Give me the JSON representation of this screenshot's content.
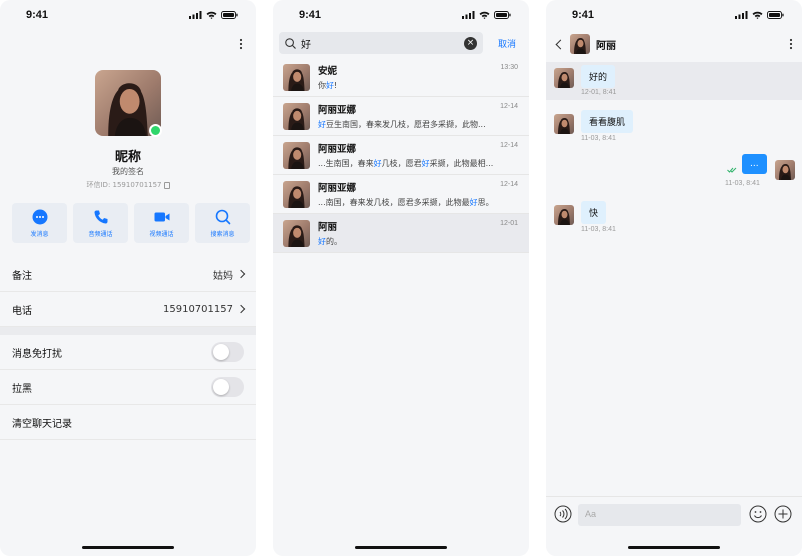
{
  "status": {
    "time": "9:41"
  },
  "profile": {
    "nickname": "昵称",
    "signature": "我的签名",
    "uid": "环信ID: 15910701157",
    "actions": [
      {
        "label": "发消息",
        "icon": "message-icon"
      },
      {
        "label": "音频通话",
        "icon": "phone-icon"
      },
      {
        "label": "视频通话",
        "icon": "video-icon"
      },
      {
        "label": "搜索消息",
        "icon": "search-icon"
      }
    ],
    "remark_label": "备注",
    "remark_value": "姑妈",
    "phone_label": "电话",
    "phone_value": "15910701157",
    "mute_label": "消息免打扰",
    "block_label": "拉黑",
    "clear_label": "清空聊天记录"
  },
  "search": {
    "query": "好",
    "cancel": "取消",
    "results": [
      {
        "name": "安妮",
        "time": "13:30",
        "pre": "你",
        "hit": "好",
        "post": "!"
      },
      {
        "name": "阿丽亚娜",
        "time": "12-14",
        "pre": "",
        "hit": "好",
        "post": "豆生南国，春来发几枝，愿君多采撷，此物..."
      },
      {
        "name": "阿丽亚娜",
        "time": "12-14",
        "pre": "...生南国，春来",
        "hit": "好",
        "post": "几枝，愿君",
        "hit2": "好",
        "post2": "采撷，此物最相..."
      },
      {
        "name": "阿丽亚娜",
        "time": "12-14",
        "pre": "...南国，春来发几枝，愿君多采撷，此物最",
        "hit": "好",
        "post": "思。"
      },
      {
        "name": "阿丽",
        "time": "12-01",
        "pre": "",
        "hit": "好",
        "post": "的。"
      }
    ]
  },
  "chat": {
    "title": "阿丽",
    "messages": [
      {
        "text": "好的",
        "time": "12-01, 8:41"
      },
      {
        "text": "看看腹肌",
        "time": "11-03, 8:41"
      },
      {
        "text": "...",
        "time": "11-03, 8:41"
      },
      {
        "text": "快",
        "time": "11-03, 8:41"
      }
    ],
    "input_placeholder": "Aa"
  }
}
